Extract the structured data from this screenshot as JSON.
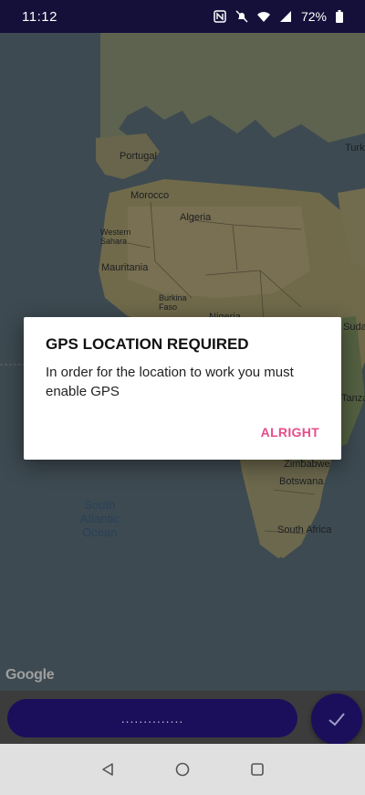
{
  "status_bar": {
    "time": "11:12",
    "battery_percent": "72%",
    "icons": [
      "nfc-icon",
      "mute-icon",
      "wifi-icon",
      "signal-icon",
      "battery-icon"
    ]
  },
  "map": {
    "labels": {
      "portugal": "Portugal",
      "morocco": "Morocco",
      "algeria": "Algeria",
      "western_sahara": "Western\nSahara",
      "mauritania": "Mauritania",
      "burkina_faso": "Burkina\nFaso",
      "nigeria": "Nigeria",
      "sudan": "Sudan",
      "tanzania": "Tanza",
      "zimbabwe": "Zimbabwe",
      "botswana": "Botswana",
      "south_africa": "South Africa",
      "turkey": "Turk",
      "ocean": "South\nAtlantic\nOcean"
    },
    "attribution": "Google"
  },
  "dialog": {
    "title": "GPS LOCATION REQUIRED",
    "message": "In order for the location to work you must enable GPS",
    "action_label": "ALRIGHT"
  },
  "bottom": {
    "pill_text": "..............",
    "fab_icon": "check-icon"
  },
  "nav": {
    "back_icon": "back-icon",
    "home_icon": "home-icon",
    "recents_icon": "recents-icon"
  },
  "colors": {
    "status_bar": "#14103a",
    "primary_dark": "#1b0f5c",
    "accent": "#e64c8c",
    "nav_bar": "#e0e0e0"
  }
}
